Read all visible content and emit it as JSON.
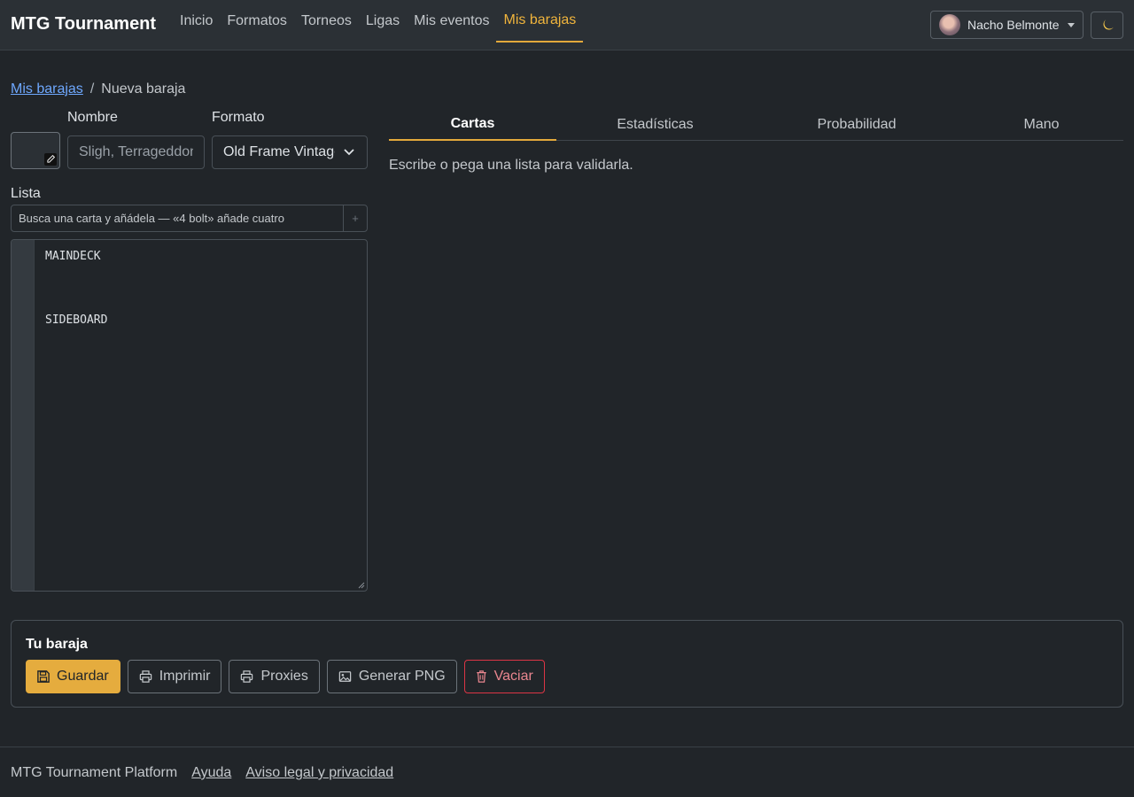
{
  "navbar": {
    "brand": "MTG Tournament",
    "links": [
      {
        "label": "Inicio"
      },
      {
        "label": "Formatos"
      },
      {
        "label": "Torneos"
      },
      {
        "label": "Ligas"
      },
      {
        "label": "Mis eventos"
      },
      {
        "label": "Mis barajas",
        "active": true
      }
    ],
    "user_name": "Nacho Belmonte",
    "theme_icon": "moon-icon",
    "accent_color": "#e3a93b"
  },
  "breadcrumb": {
    "parent": "Mis barajas",
    "separator": "/",
    "current": "Nueva baraja"
  },
  "form": {
    "name_label": "Nombre",
    "name_placeholder": "Sligh, Terrageddon",
    "format_label": "Formato",
    "format_value": "Old Frame Vintage",
    "list_label": "Lista",
    "search_placeholder": "Busca una carta y añádela — «4 bolt» añade cuatro",
    "search_add": "+",
    "editor_lines": [
      "MAINDECK",
      "",
      "",
      "",
      "SIDEBOARD"
    ]
  },
  "tabs": {
    "items": [
      {
        "label": "Cartas",
        "active": true
      },
      {
        "label": "Estadísticas"
      },
      {
        "label": "Probabilidad"
      },
      {
        "label": "Mano"
      }
    ],
    "hint": "Escribe o pega una lista para validarla."
  },
  "deck_panel": {
    "title": "Tu baraja",
    "buttons": {
      "save": "Guardar",
      "print": "Imprimir",
      "proxies": "Proxies",
      "png": "Generar PNG",
      "clear": "Vaciar"
    }
  },
  "footer": {
    "platform": "MTG Tournament Platform",
    "help": "Ayuda",
    "legal": "Aviso legal y privacidad"
  }
}
